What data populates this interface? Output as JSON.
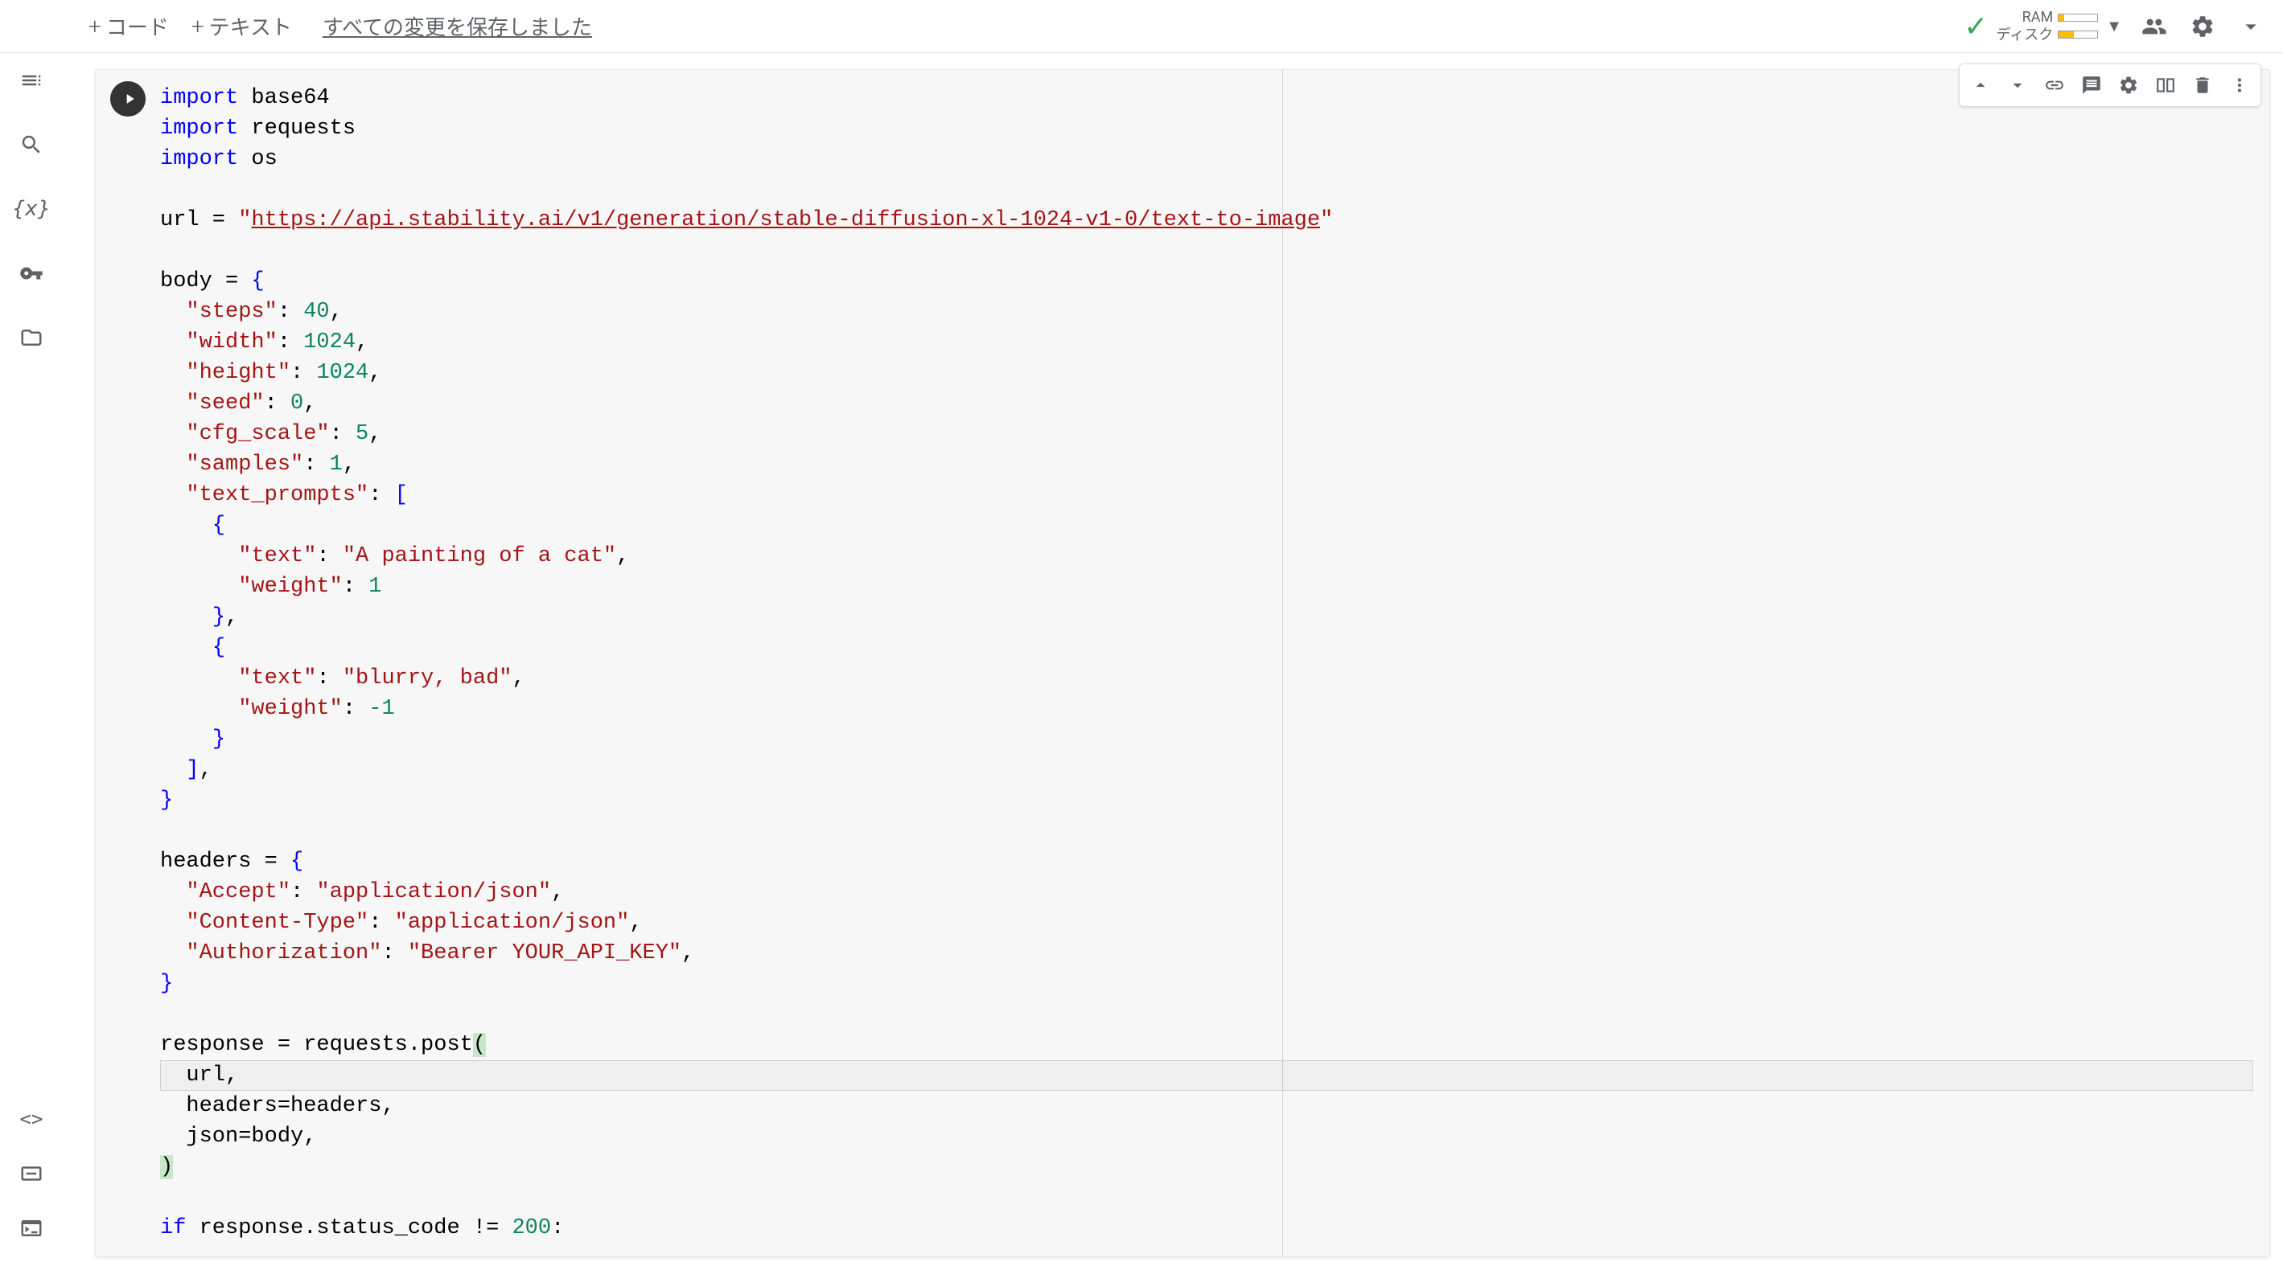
{
  "topbar": {
    "code_button": "コード",
    "text_button": "テキスト",
    "save_status": "すべての変更を保存しました",
    "ram_label": "RAM",
    "disk_label": "ディスク"
  },
  "sidebar": {
    "items": [
      "table-of-contents",
      "search",
      "variables",
      "secrets",
      "files"
    ],
    "bottom_items": [
      "code-snippets",
      "command-palette",
      "terminal"
    ]
  },
  "cell_toolbar": {
    "items": [
      "move-up",
      "move-down",
      "link",
      "comment",
      "settings",
      "mirror",
      "delete",
      "more"
    ]
  },
  "code": {
    "lines": [
      {
        "t": "import",
        "p": [
          [
            "kw",
            "import"
          ],
          [
            "",
            " base64"
          ]
        ]
      },
      {
        "t": "import",
        "p": [
          [
            "kw",
            "import"
          ],
          [
            "",
            " requests"
          ]
        ]
      },
      {
        "t": "import",
        "p": [
          [
            "kw",
            "import"
          ],
          [
            "",
            " os"
          ]
        ]
      },
      {
        "t": "blank",
        "p": [
          [
            "",
            ""
          ]
        ]
      },
      {
        "t": "assign",
        "p": [
          [
            "",
            "url = "
          ],
          [
            "str",
            "\""
          ],
          [
            "url",
            "https://api.stability.ai/v1/generation/stable-diffusion-xl-1024-v1-0/text-to-image"
          ],
          [
            "str",
            "\""
          ]
        ]
      },
      {
        "t": "blank",
        "p": [
          [
            "",
            ""
          ]
        ]
      },
      {
        "t": "assign",
        "p": [
          [
            "",
            "body = "
          ],
          [
            "brace",
            "{"
          ]
        ]
      },
      {
        "t": "dict",
        "p": [
          [
            "",
            "  "
          ],
          [
            "str",
            "\"steps\""
          ],
          [
            "",
            ": "
          ],
          [
            "num",
            "40"
          ],
          [
            "",
            ","
          ]
        ]
      },
      {
        "t": "dict",
        "p": [
          [
            "",
            "  "
          ],
          [
            "str",
            "\"width\""
          ],
          [
            "",
            ": "
          ],
          [
            "num",
            "1024"
          ],
          [
            "",
            ","
          ]
        ]
      },
      {
        "t": "dict",
        "p": [
          [
            "",
            "  "
          ],
          [
            "str",
            "\"height\""
          ],
          [
            "",
            ": "
          ],
          [
            "num",
            "1024"
          ],
          [
            "",
            ","
          ]
        ]
      },
      {
        "t": "dict",
        "p": [
          [
            "",
            "  "
          ],
          [
            "str",
            "\"seed\""
          ],
          [
            "",
            ": "
          ],
          [
            "num",
            "0"
          ],
          [
            "",
            ","
          ]
        ]
      },
      {
        "t": "dict",
        "p": [
          [
            "",
            "  "
          ],
          [
            "str",
            "\"cfg_scale\""
          ],
          [
            "",
            ": "
          ],
          [
            "num",
            "5"
          ],
          [
            "",
            ","
          ]
        ]
      },
      {
        "t": "dict",
        "p": [
          [
            "",
            "  "
          ],
          [
            "str",
            "\"samples\""
          ],
          [
            "",
            ": "
          ],
          [
            "num",
            "1"
          ],
          [
            "",
            ","
          ]
        ]
      },
      {
        "t": "dict",
        "p": [
          [
            "",
            "  "
          ],
          [
            "str",
            "\"text_prompts\""
          ],
          [
            "",
            ": "
          ],
          [
            "brace",
            "["
          ]
        ]
      },
      {
        "t": "dict",
        "p": [
          [
            "",
            "    "
          ],
          [
            "brace",
            "{"
          ]
        ]
      },
      {
        "t": "dict",
        "p": [
          [
            "",
            "      "
          ],
          [
            "str",
            "\"text\""
          ],
          [
            "",
            ": "
          ],
          [
            "str",
            "\"A painting of a cat\""
          ],
          [
            "",
            ","
          ]
        ]
      },
      {
        "t": "dict",
        "p": [
          [
            "",
            "      "
          ],
          [
            "str",
            "\"weight\""
          ],
          [
            "",
            ": "
          ],
          [
            "num",
            "1"
          ]
        ]
      },
      {
        "t": "dict",
        "p": [
          [
            "",
            "    "
          ],
          [
            "brace",
            "}"
          ],
          [
            "",
            ","
          ]
        ]
      },
      {
        "t": "dict",
        "p": [
          [
            "",
            "    "
          ],
          [
            "brace",
            "{"
          ]
        ]
      },
      {
        "t": "dict",
        "p": [
          [
            "",
            "      "
          ],
          [
            "str",
            "\"text\""
          ],
          [
            "",
            ": "
          ],
          [
            "str",
            "\"blurry, bad\""
          ],
          [
            "",
            ","
          ]
        ]
      },
      {
        "t": "dict",
        "p": [
          [
            "",
            "      "
          ],
          [
            "str",
            "\"weight\""
          ],
          [
            "",
            ": "
          ],
          [
            "num",
            "-1"
          ]
        ]
      },
      {
        "t": "dict",
        "p": [
          [
            "",
            "    "
          ],
          [
            "brace",
            "}"
          ]
        ]
      },
      {
        "t": "dict",
        "p": [
          [
            "",
            "  "
          ],
          [
            "brace",
            "]"
          ],
          [
            "",
            ","
          ]
        ]
      },
      {
        "t": "dict",
        "p": [
          [
            "brace",
            "}"
          ]
        ]
      },
      {
        "t": "blank",
        "p": [
          [
            "",
            ""
          ]
        ]
      },
      {
        "t": "assign",
        "p": [
          [
            "",
            "headers = "
          ],
          [
            "brace",
            "{"
          ]
        ]
      },
      {
        "t": "dict",
        "p": [
          [
            "",
            "  "
          ],
          [
            "str",
            "\"Accept\""
          ],
          [
            "",
            ": "
          ],
          [
            "str",
            "\"application/json\""
          ],
          [
            "",
            ","
          ]
        ]
      },
      {
        "t": "dict",
        "p": [
          [
            "",
            "  "
          ],
          [
            "str",
            "\"Content-Type\""
          ],
          [
            "",
            ": "
          ],
          [
            "str",
            "\"application/json\""
          ],
          [
            "",
            ","
          ]
        ]
      },
      {
        "t": "dict",
        "p": [
          [
            "",
            "  "
          ],
          [
            "str",
            "\"Authorization\""
          ],
          [
            "",
            ": "
          ],
          [
            "str",
            "\"Bearer YOUR_API_KEY\""
          ],
          [
            "",
            ","
          ]
        ]
      },
      {
        "t": "dict",
        "p": [
          [
            "brace",
            "}"
          ]
        ]
      },
      {
        "t": "blank",
        "p": [
          [
            "",
            ""
          ]
        ]
      },
      {
        "t": "call",
        "p": [
          [
            "",
            "response = requests.post"
          ],
          [
            "parenhl",
            "("
          ]
        ]
      },
      {
        "t": "arg",
        "p": [
          [
            "",
            "  url,"
          ]
        ],
        "cursor": true
      },
      {
        "t": "arg",
        "p": [
          [
            "",
            "  headers=headers,"
          ]
        ]
      },
      {
        "t": "arg",
        "p": [
          [
            "",
            "  json=body,"
          ]
        ]
      },
      {
        "t": "call",
        "p": [
          [
            "parenhl",
            ")"
          ]
        ]
      },
      {
        "t": "blank",
        "p": [
          [
            "",
            ""
          ]
        ]
      },
      {
        "t": "if",
        "p": [
          [
            "kw",
            "if"
          ],
          [
            "",
            " response.status_code != "
          ],
          [
            "num",
            "200"
          ],
          [
            "",
            ":"
          ]
        ]
      }
    ]
  }
}
